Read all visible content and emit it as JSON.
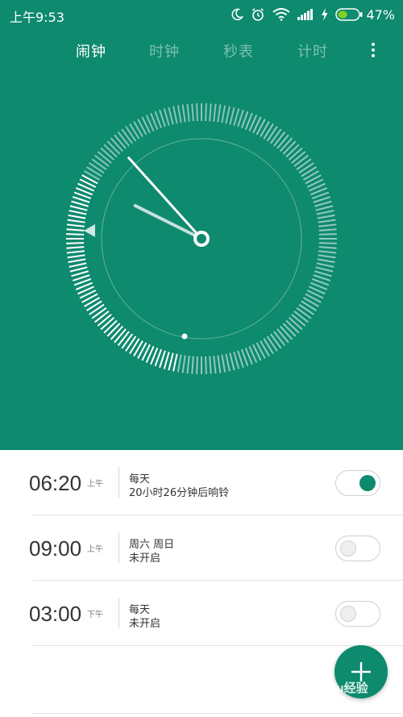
{
  "status_bar": {
    "time": "上午9:53",
    "battery_percent": "47%",
    "battery_level": 0.47,
    "icons": [
      "moon-icon",
      "alarm-icon",
      "wifi-icon",
      "signal-icon",
      "charging-icon",
      "battery-icon"
    ]
  },
  "tabs": [
    {
      "label": "闹钟",
      "active": true
    },
    {
      "label": "时钟",
      "active": false
    },
    {
      "label": "秒表",
      "active": false
    },
    {
      "label": "计时",
      "active": false
    }
  ],
  "clock": {
    "hour": 9,
    "minute": 53,
    "indicator_icon": "triangle-left-icon"
  },
  "alarms": [
    {
      "time": "06:20",
      "ampm": "上午",
      "repeat": "每天",
      "status": "20小时26分钟后响铃",
      "enabled": true
    },
    {
      "time": "09:00",
      "ampm": "上午",
      "repeat": "周六 周日",
      "status": "未开启",
      "enabled": false
    },
    {
      "time": "03:00",
      "ampm": "下午",
      "repeat": "每天",
      "status": "未开启",
      "enabled": false
    }
  ],
  "fab": {
    "icon": "plus-icon"
  },
  "watermark": "Baidu经验",
  "colors": {
    "accent": "#0e8a6e",
    "text": "#333333",
    "muted": "#777777"
  }
}
